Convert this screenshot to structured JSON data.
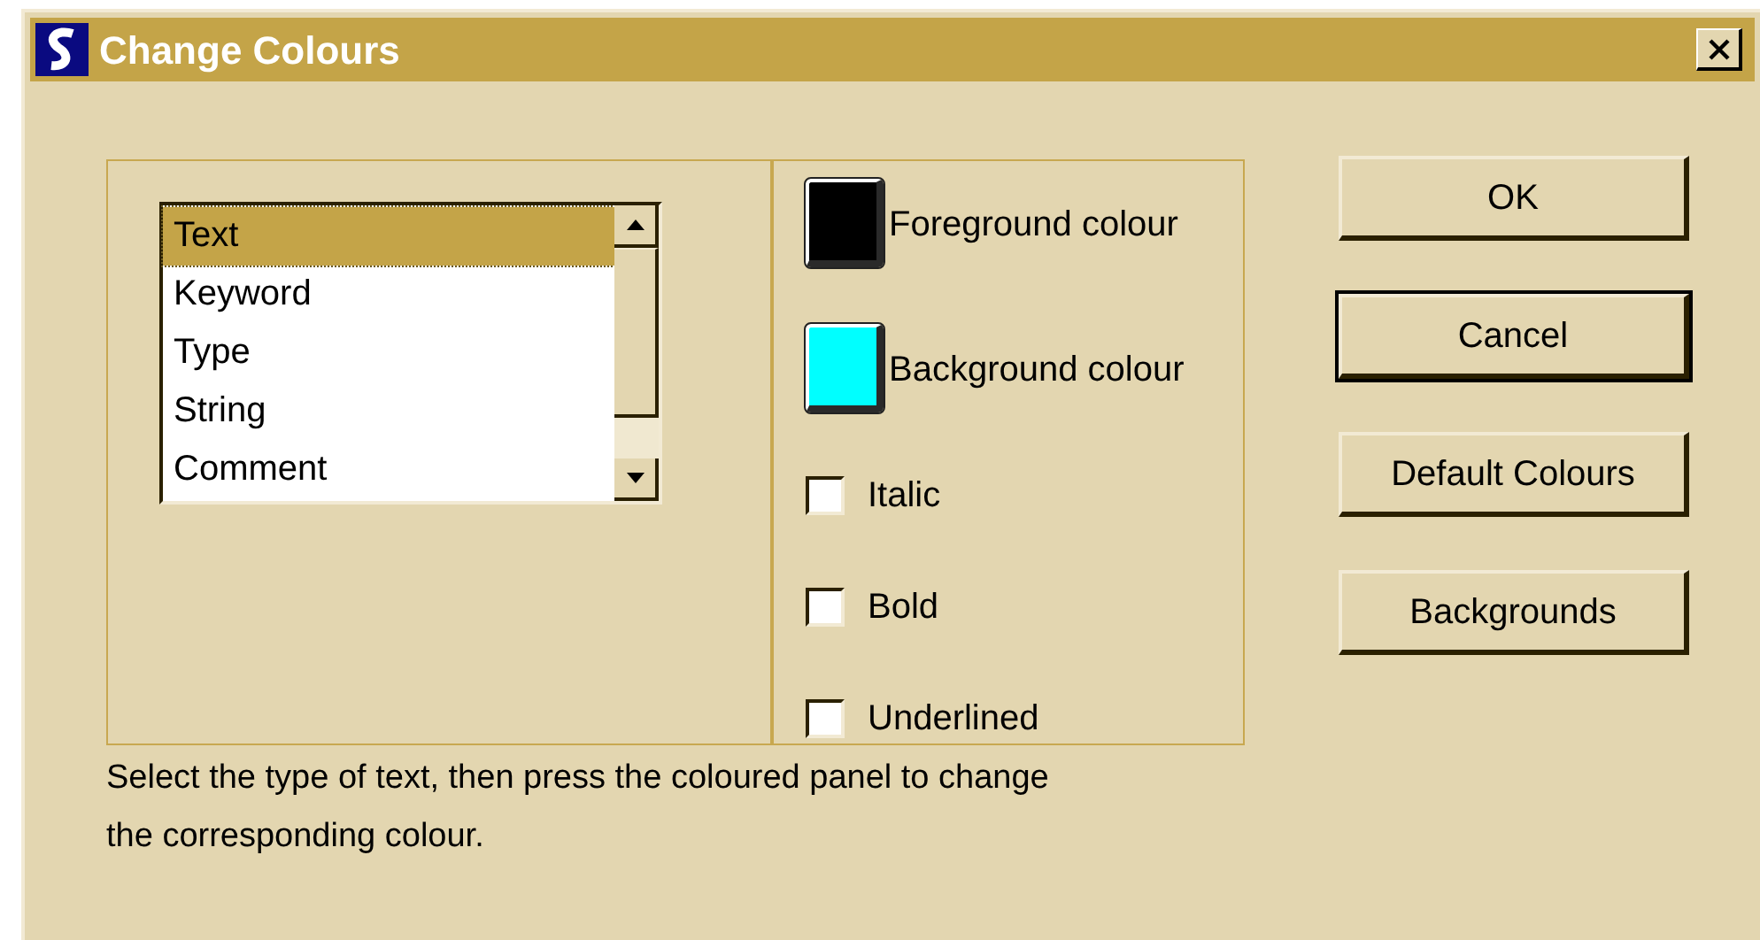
{
  "window": {
    "title": "Change Colours"
  },
  "text_types": [
    {
      "label": "Text",
      "selected": true
    },
    {
      "label": "Keyword",
      "selected": false
    },
    {
      "label": "Type",
      "selected": false
    },
    {
      "label": "String",
      "selected": false
    },
    {
      "label": "Comment",
      "selected": false
    }
  ],
  "colour_panels": [
    {
      "label": "Foreground colour",
      "color": "#000000"
    },
    {
      "label": "Background colour",
      "color": "#00ffff"
    }
  ],
  "styles": [
    {
      "label": "Italic",
      "checked": false
    },
    {
      "label": "Bold",
      "checked": false
    },
    {
      "label": "Underlined",
      "checked": false
    }
  ],
  "buttons": [
    {
      "label": "OK",
      "default": false
    },
    {
      "label": "Cancel",
      "default": true
    },
    {
      "label": "Default Colours",
      "default": false
    },
    {
      "label": "Backgrounds",
      "default": false
    }
  ],
  "hint": "Select the type of text, then press the coloured panel to change the corresponding colour."
}
